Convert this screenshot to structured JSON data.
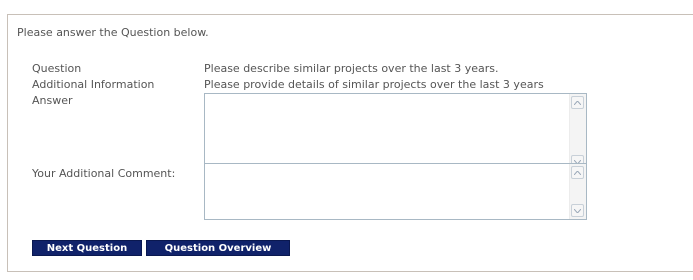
{
  "form": {
    "intro": "Please answer the Question below.",
    "question_label": "Question",
    "question_value": "Please describe similar projects over the last 3 years.",
    "additional_info_label": "Additional Information",
    "additional_info_value": "Please provide details of similar projects over the last 3 years",
    "answer_label": "Answer",
    "answer_value": "",
    "comment_label": "Your Additional Comment:",
    "comment_value": ""
  },
  "buttons": {
    "next_question": "Next Question",
    "question_overview": "Question Overview"
  },
  "colors": {
    "button_bg": "#10226a",
    "border": "#c8c0b8"
  }
}
